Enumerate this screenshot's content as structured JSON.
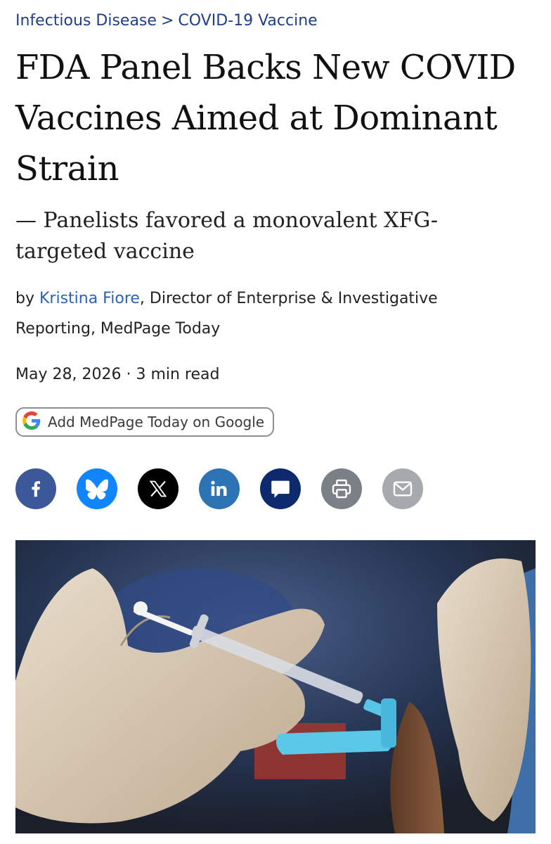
{
  "breadcrumb": {
    "items": [
      "Infectious Disease",
      "COVID-19 Vaccine"
    ],
    "separator": ">"
  },
  "article": {
    "title": "FDA Panel Backs New COVID Vaccines Aimed at Dominant Strain",
    "subtitle": "— Panelists favored a monovalent XFG-targeted vaccine",
    "byline_prefix": "by",
    "author": "Kristina Fiore",
    "author_role": ", Director of Enterprise & Investigative Reporting, MedPage Today",
    "date": "May 28, 2026",
    "meta_separator": "·",
    "read_time": "3 min read"
  },
  "google_button": {
    "label": "Add MedPage Today on Google",
    "icon": "google-g-icon"
  },
  "share": {
    "items": [
      {
        "name": "facebook",
        "icon": "facebook-icon",
        "color": "#3b5998"
      },
      {
        "name": "bluesky",
        "icon": "bluesky-icon",
        "color": "#1185fe"
      },
      {
        "name": "x",
        "icon": "x-icon",
        "color": "#000000"
      },
      {
        "name": "linkedin",
        "icon": "linkedin-icon",
        "color": "#2c74b3"
      },
      {
        "name": "comments",
        "icon": "comment-icon",
        "color": "#0e2a6e"
      },
      {
        "name": "print",
        "icon": "print-icon",
        "color": "#7b7f86"
      },
      {
        "name": "email",
        "icon": "mail-icon",
        "color": "#a6a9ae"
      }
    ]
  },
  "hero_image": {
    "subject": "gloved hands administering a vaccine injection into an upper arm"
  },
  "colors": {
    "link": "#2c63b8",
    "breadcrumb": "#1f3f8a",
    "text": "#222222"
  }
}
